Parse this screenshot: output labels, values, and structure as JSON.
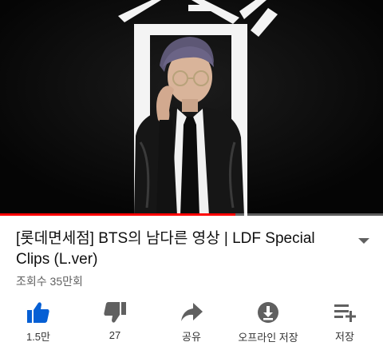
{
  "video": {
    "progress_fraction": 0.615
  },
  "metadata": {
    "title": "[롯데면세점] BTS의 남다른 영상 | LDF Special Clips (L.ver)",
    "views": "조회수 35만회"
  },
  "actions": {
    "like": {
      "label": "1.5만",
      "icon": "thumb-up-icon",
      "color": "#065fd4"
    },
    "dislike": {
      "label": "27",
      "icon": "thumb-down-icon"
    },
    "share": {
      "label": "공유",
      "icon": "share-icon"
    },
    "offline": {
      "label": "오프라인 저장",
      "icon": "download-icon"
    },
    "save": {
      "label": "저장",
      "icon": "playlist-add-icon"
    }
  }
}
